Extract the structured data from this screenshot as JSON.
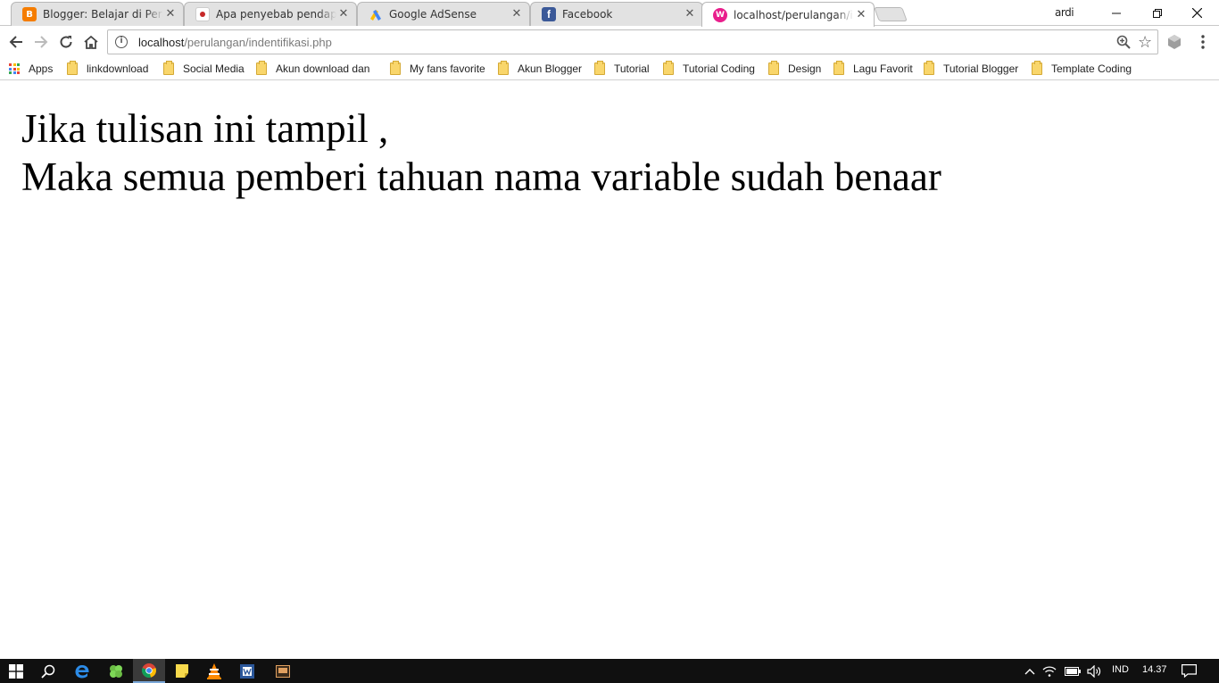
{
  "browser": {
    "tabs": [
      {
        "label": "Blogger: Belajar di Perant",
        "favicon": "blogger-icon",
        "color": "#f57d00",
        "active": false
      },
      {
        "label": "Apa penyebab pendapat",
        "favicon": "page-icon",
        "color": "#c62828",
        "active": false
      },
      {
        "label": "Google AdSense",
        "favicon": "adsense-icon",
        "color": "#fbbc04",
        "active": false
      },
      {
        "label": "Facebook",
        "favicon": "facebook-icon",
        "color": "#3b5998",
        "active": false
      },
      {
        "label": "localhost/perulangan/inc",
        "favicon": "localhost-icon",
        "color": "#e91e8c",
        "active": true
      }
    ],
    "profile_name": "ardi",
    "address": {
      "host": "localhost",
      "path": "/perulangan/indentifikasi.php"
    },
    "bookmarks": [
      {
        "label": "Apps",
        "type": "apps"
      },
      {
        "label": "linkdownload",
        "type": "folder"
      },
      {
        "label": "Social Media",
        "type": "folder"
      },
      {
        "label": "Akun download dan",
        "type": "folder"
      },
      {
        "label": "My fans favorite",
        "type": "folder"
      },
      {
        "label": "Akun Blogger",
        "type": "folder"
      },
      {
        "label": "Tutorial",
        "type": "folder"
      },
      {
        "label": "Tutorial Coding",
        "type": "folder"
      },
      {
        "label": "Design",
        "type": "folder"
      },
      {
        "label": "Lagu Favorit",
        "type": "folder"
      },
      {
        "label": "Tutorial Blogger",
        "type": "folder"
      },
      {
        "label": "Template Coding",
        "type": "folder"
      }
    ]
  },
  "page": {
    "lines": [
      "Jika tulisan ini tampil ,",
      "Maka semua pemberi tahuan nama variable sudah benaar"
    ]
  },
  "taskbar": {
    "language": "IND",
    "clock": "14.37"
  },
  "colors": {
    "accent": "#7aa7d8",
    "taskbar_bg": "#101010"
  }
}
